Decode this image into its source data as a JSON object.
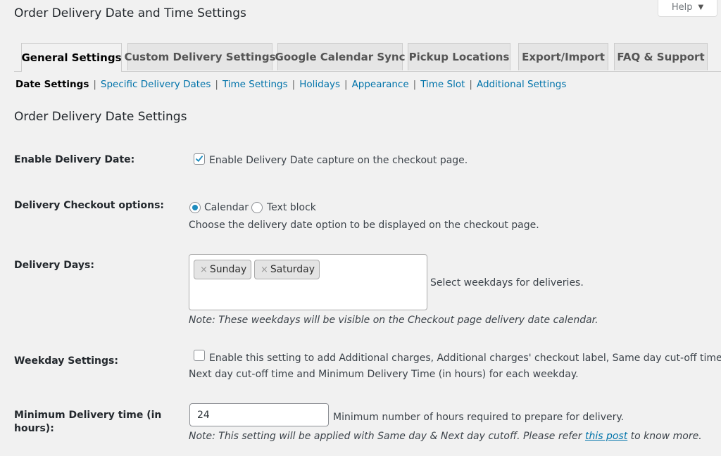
{
  "page": {
    "title": "Order Delivery Date and Time Settings",
    "help_label": "Help"
  },
  "tabs": [
    {
      "label": "General Settings",
      "active": true
    },
    {
      "label": "Custom Delivery Settings",
      "active": false
    },
    {
      "label": "Google Calendar Sync",
      "active": false
    },
    {
      "label": "Pickup Locations",
      "active": false
    },
    {
      "label": "Export/Import",
      "active": false
    },
    {
      "label": "FAQ & Support",
      "active": false
    }
  ],
  "subnav": {
    "current": "Date Settings",
    "links": [
      "Specific Delivery Dates",
      "Time Settings",
      "Holidays",
      "Appearance",
      "Time Slot",
      "Additional Settings"
    ],
    "separator": "|"
  },
  "section": {
    "title": "Order Delivery Date Settings"
  },
  "fields": {
    "enable_delivery_date": {
      "label": "Enable Delivery Date:",
      "checked": true,
      "description": "Enable Delivery Date capture on the checkout page."
    },
    "checkout_options": {
      "label": "Delivery Checkout options:",
      "options": [
        "Calendar",
        "Text block"
      ],
      "selected": "Calendar",
      "description": "Choose the delivery date option to be displayed on the checkout page."
    },
    "delivery_days": {
      "label": "Delivery Days:",
      "selected": [
        "Sunday",
        "Saturday"
      ],
      "remove_glyph": "×",
      "description": "Select weekdays for deliveries.",
      "note": "Note: These weekdays will be visible on the Checkout page delivery date calendar."
    },
    "weekday_settings": {
      "label": "Weekday Settings:",
      "checked": false,
      "description_line1": "Enable this setting to add Additional charges, Additional charges' checkout label, Same day cut-off time,",
      "description_line2": "Next day cut-off time and Minimum Delivery Time (in hours) for each weekday."
    },
    "minimum_delivery_time": {
      "label_line1": "Minimum Delivery time (in",
      "label_line2": "hours):",
      "value": "24",
      "description": "Minimum number of hours required to prepare for delivery.",
      "note_before": "Note: This setting will be applied with Same day & Next day cutoff. Please refer ",
      "note_link": "this post",
      "note_after": " to know more."
    }
  }
}
